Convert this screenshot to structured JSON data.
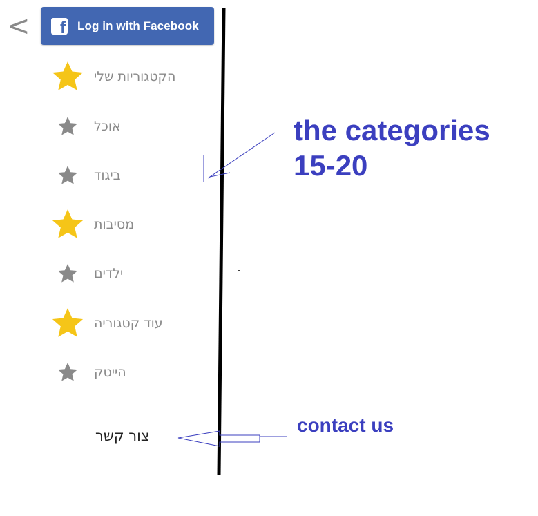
{
  "header": {
    "back_glyph": "<",
    "facebook_button": {
      "logo_letter": "f",
      "label": "Log in with Facebook"
    }
  },
  "categories": [
    {
      "label": "הקטגוריות שלי",
      "starred": true
    },
    {
      "label": "אוכל",
      "starred": false
    },
    {
      "label": "ביגוד",
      "starred": false
    },
    {
      "label": "מסיבות",
      "starred": true
    },
    {
      "label": "ילדים",
      "starred": false
    },
    {
      "label": "עוד  קטגוריה",
      "starred": true
    },
    {
      "label": "הייטק",
      "starred": false
    }
  ],
  "contact": {
    "label": "צור קשר"
  },
  "annotations": {
    "categories_note": "the categories 15-20",
    "contact_note": "contact us"
  },
  "colors": {
    "facebook_blue": "#4267b2",
    "star_gold": "#f5c518",
    "star_gray": "#8a8a8a",
    "annotation_blue": "#3b3fbf"
  },
  "icons": {
    "starred": "star-gold-icon",
    "unstarred": "star-gray-icon",
    "back": "chevron-left-icon"
  }
}
